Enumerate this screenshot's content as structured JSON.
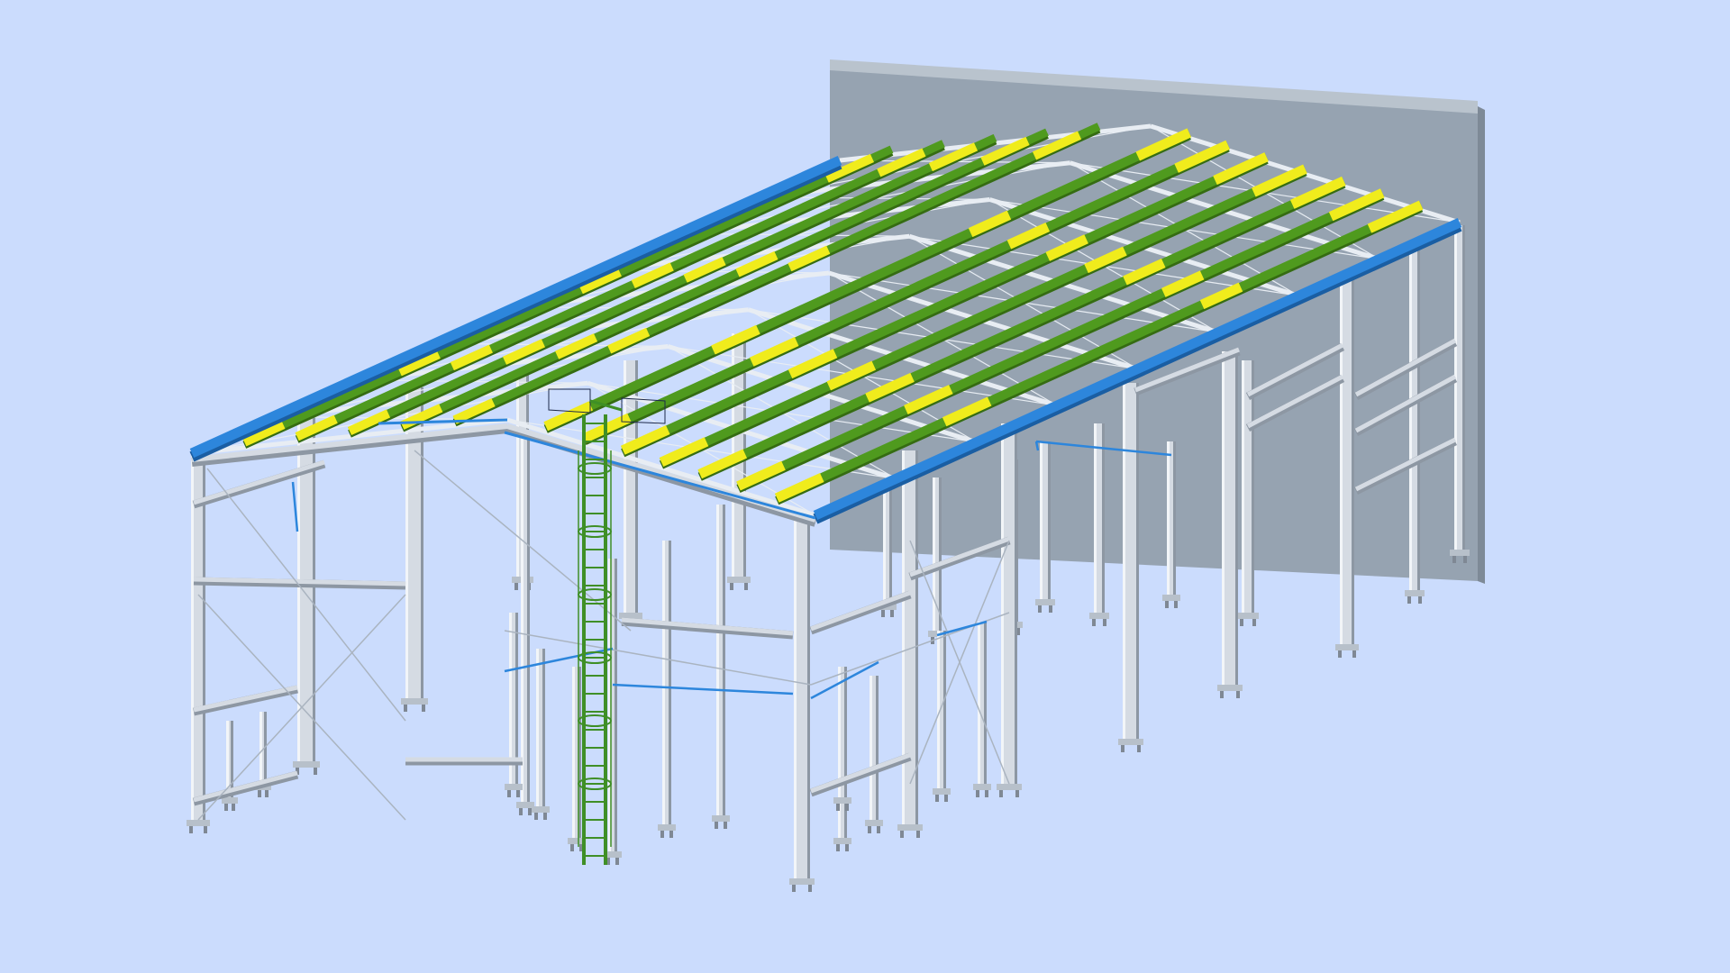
{
  "scene": {
    "subject": "steel-frame-building-3d-model",
    "colors": {
      "background": "#cbdcfd",
      "wall": "#96a3b1",
      "wall_edge": "#b9c3cd",
      "steel": "#d5dbe3",
      "steel_dark": "#8d97a3",
      "purlin_green": "#4f9a1e",
      "purlin_green_dark": "#356c12",
      "purlin_yellow": "#f0ec1c",
      "eave_blue": "#2d86dc",
      "bracing": "#e8edf3",
      "ladder": "#3f8f26",
      "hatch_frame": "#1e2a4a"
    }
  }
}
